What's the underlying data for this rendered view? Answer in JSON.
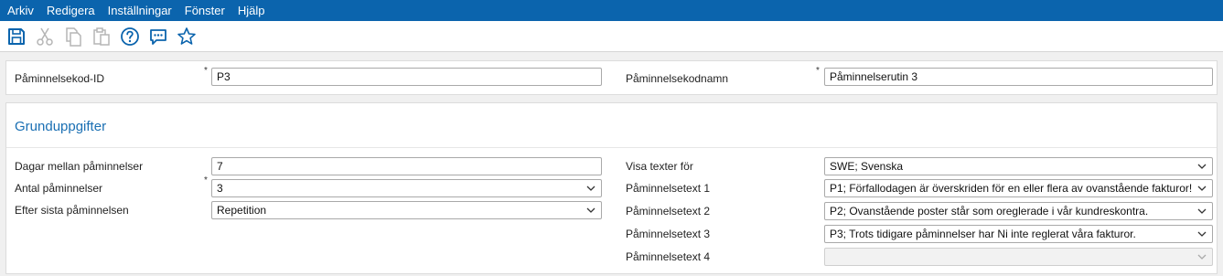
{
  "menu": [
    "Arkiv",
    "Redigera",
    "Inställningar",
    "Fönster",
    "Hjälp"
  ],
  "toolbar": {
    "icons": [
      "save-icon",
      "cut-icon",
      "copy-icon",
      "paste-icon",
      "help-icon",
      "comment-icon",
      "favorite-star-icon"
    ],
    "accent": "#0b64ad"
  },
  "id_section": {
    "code_label": "Påminnelsekod-ID",
    "code_value": "P3",
    "name_label": "Påminnelsekodnamn",
    "name_value": "Påminnelserutin 3",
    "required_mark": "*"
  },
  "basic": {
    "title": "Grunduppgifter",
    "days_label": "Dagar mellan påminnelser",
    "days_value": "7",
    "count_label": "Antal påminnelser",
    "count_value": "3",
    "after_label": "Efter sista påminnelsen",
    "after_value": "Repetition",
    "lang_label": "Visa texter för",
    "lang_value": "SWE; Svenska",
    "text1_label": "Påminnelsetext 1",
    "text1_value": "P1; Förfallodagen är överskriden för en eller flera av ovanstående fakturor!",
    "text2_label": "Påminnelsetext 2",
    "text2_value": "P2; Ovanstående poster står som oreglerade i vår kundreskontra.",
    "text3_label": "Påminnelsetext 3",
    "text3_value": "P3; Trots tidigare påminnelser har Ni inte reglerat våra fakturor.",
    "text4_label": "Påminnelsetext 4",
    "text4_value": "",
    "required_mark": "*"
  }
}
